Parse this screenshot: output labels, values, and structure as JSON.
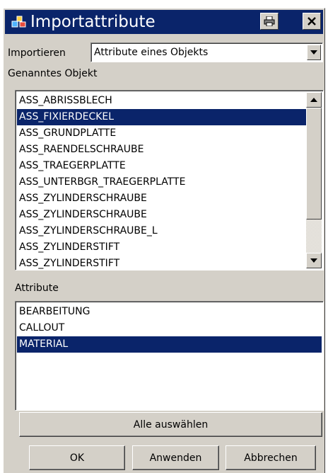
{
  "window": {
    "title": "Importattribute"
  },
  "import": {
    "label": "Importieren",
    "selected": "Attribute eines Objekts"
  },
  "objects": {
    "label": "Genanntes Objekt",
    "items": [
      "ASS_ABRISSBLECH",
      "ASS_FIXIERDECKEL",
      "ASS_GRUNDPLATTE",
      "ASS_RAENDELSCHRAUBE",
      "ASS_TRAEGERPLATTE",
      "ASS_UNTERBGR_TRAEGERPLATTE",
      "ASS_ZYLINDERSCHRAUBE",
      "ASS_ZYLINDERSCHRAUBE",
      "ASS_ZYLINDERSCHRAUBE_L",
      "ASS_ZYLINDERSTIFT",
      "ASS_ZYLINDERSTIFT"
    ],
    "selected_index": 1
  },
  "attributes": {
    "label": "Attribute",
    "items": [
      "BEARBEITUNG",
      "CALLOUT",
      "MATERIAL"
    ],
    "selected_index": 2
  },
  "buttons": {
    "select_all": "Alle auswählen",
    "ok": "OK",
    "apply": "Anwenden",
    "cancel": "Abbrechen"
  },
  "colors": {
    "selection": "#0a246a",
    "face": "#d4d0c8"
  }
}
